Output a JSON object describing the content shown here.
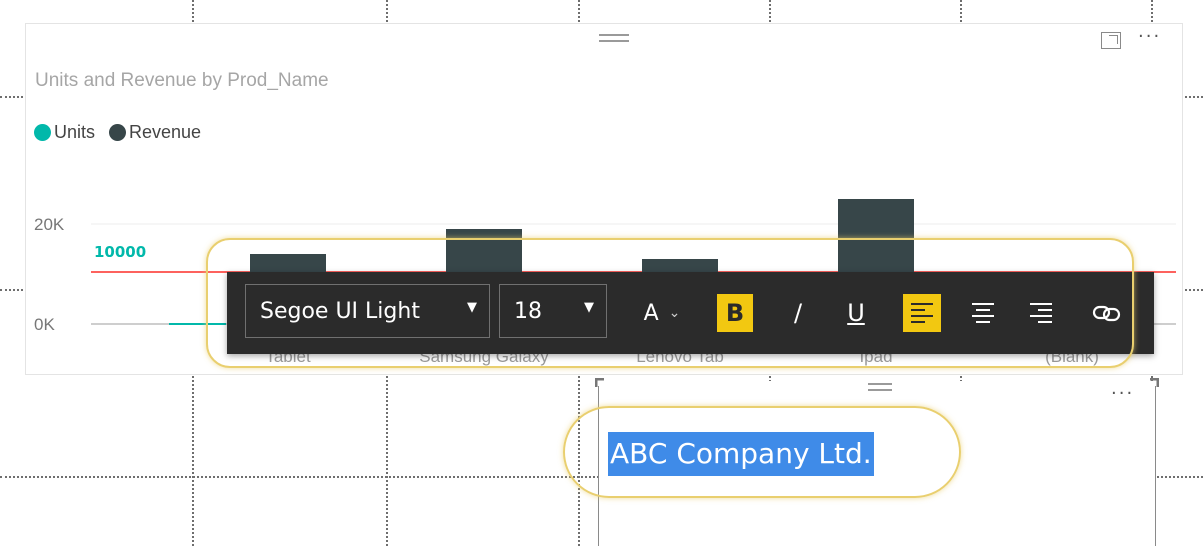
{
  "chart": {
    "title": "Units and Revenue by Prod_Name",
    "legend": [
      {
        "label": "Units",
        "color": "#01b8aa"
      },
      {
        "label": "Revenue",
        "color": "#374649"
      }
    ],
    "icons": {
      "drag": "drag-handle-icon",
      "focus": "focus-mode-icon",
      "more": "more-options-icon"
    },
    "more_label": "···"
  },
  "chart_data": {
    "type": "bar",
    "title": "Units and Revenue by Prod_Name",
    "categories": [
      "Tablet",
      "Samsung Galaxy",
      "Lenovo Tab",
      "Ipad",
      "(Blank)"
    ],
    "category_labels_shown": [
      "Tablet",
      "Samsung Galaxy",
      "Lenovo Tab",
      "Ipad",
      "(Blank)"
    ],
    "series": [
      {
        "name": "Units",
        "values": [
          0,
          0,
          0,
          0,
          0
        ],
        "color": "#01b8aa"
      },
      {
        "name": "Revenue",
        "values": [
          14000,
          19000,
          13000,
          25000,
          0
        ],
        "color": "#374649"
      }
    ],
    "y_ticks": [
      "20K",
      "0K"
    ],
    "ylim": [
      0,
      20000
    ],
    "reference_line": {
      "value": 10000,
      "label": "10000",
      "color": "#fd625e"
    },
    "legend_position": "top-left"
  },
  "toolbar": {
    "font_family": "Segoe UI Light",
    "font_size": "18",
    "font_color_label": "A",
    "bold_label": "B",
    "italic_label": "/",
    "underline_label": "U",
    "icons": {
      "font_dropdown": "dropdown-arrow-icon",
      "size_dropdown": "dropdown-arrow-icon",
      "font_color": "font-color-icon",
      "align_left": "align-left-icon",
      "align_center": "align-center-icon",
      "align_right": "align-right-icon",
      "link": "link-icon"
    },
    "accent_color": "#f2c811"
  },
  "textbox": {
    "text": "ABC Company Ltd.",
    "more_label": "···"
  },
  "colors": {
    "highlight": "#e9cf6f",
    "selection": "#3f8be8"
  }
}
